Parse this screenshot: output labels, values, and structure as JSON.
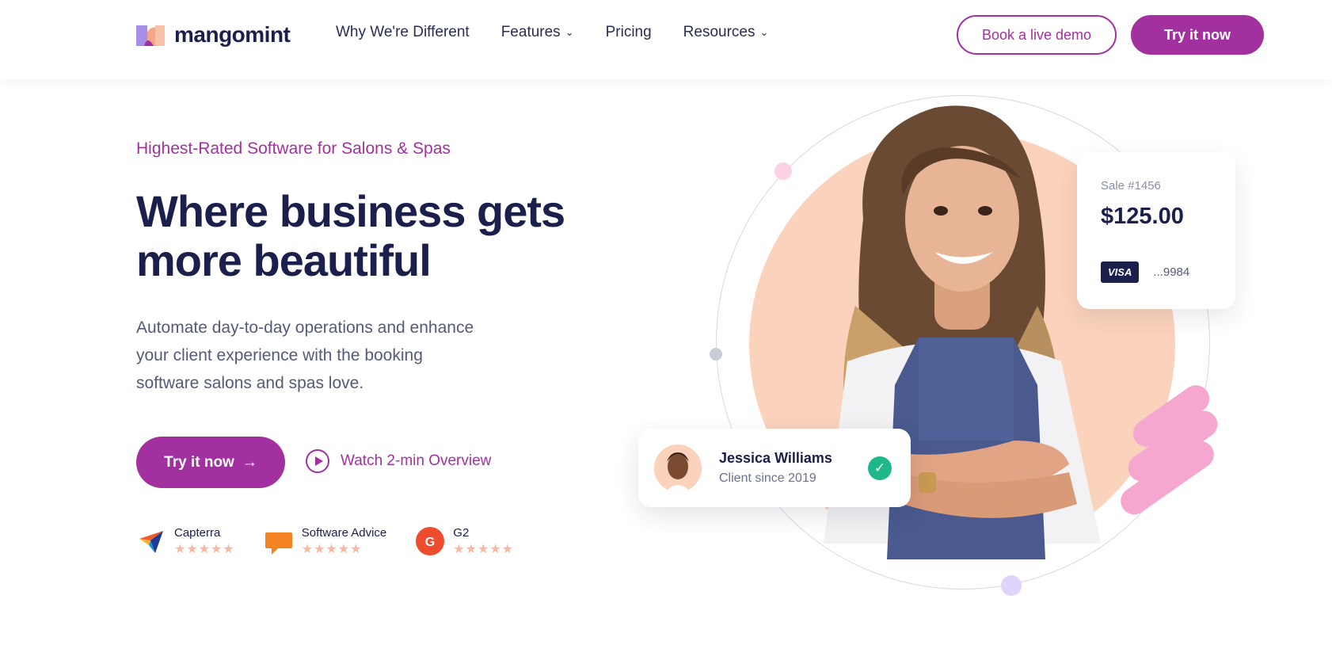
{
  "brand": {
    "name": "mangomint",
    "accent": "#a3309f",
    "navy": "#1b1f4b"
  },
  "nav": {
    "links": [
      {
        "label": "Why We're Different",
        "dropdown": false
      },
      {
        "label": "Features",
        "dropdown": true
      },
      {
        "label": "Pricing",
        "dropdown": false
      },
      {
        "label": "Resources",
        "dropdown": true
      }
    ],
    "demo_button": "Book a live demo",
    "try_button": "Try it now"
  },
  "hero": {
    "eyebrow": "Highest-Rated Software for Salons & Spas",
    "headline": "Where business gets more beautiful",
    "subtext": "Automate day-to-day operations and enhance your client experience with the booking software salons and spas love.",
    "cta_label": "Try it now",
    "cta_arrow": "→",
    "watch_label": "Watch 2-min Overview"
  },
  "ratings": [
    {
      "name": "Capterra",
      "icon": "capterra-icon",
      "stars": 5
    },
    {
      "name": "Software Advice",
      "icon": "software-advice-icon",
      "stars": 5
    },
    {
      "name": "G2",
      "icon": "g2-icon",
      "stars": 5
    }
  ],
  "sale_card": {
    "label": "Sale #1456",
    "amount": "$125.00",
    "card_brand": "VISA",
    "card_last4": "...9984"
  },
  "client_card": {
    "name": "Jessica Williams",
    "since": "Client since 2019",
    "status_icon": "check-icon"
  },
  "colors": {
    "peach": "#fbd3bc",
    "success": "#1fb88b",
    "pink": "#f6a7cf"
  }
}
